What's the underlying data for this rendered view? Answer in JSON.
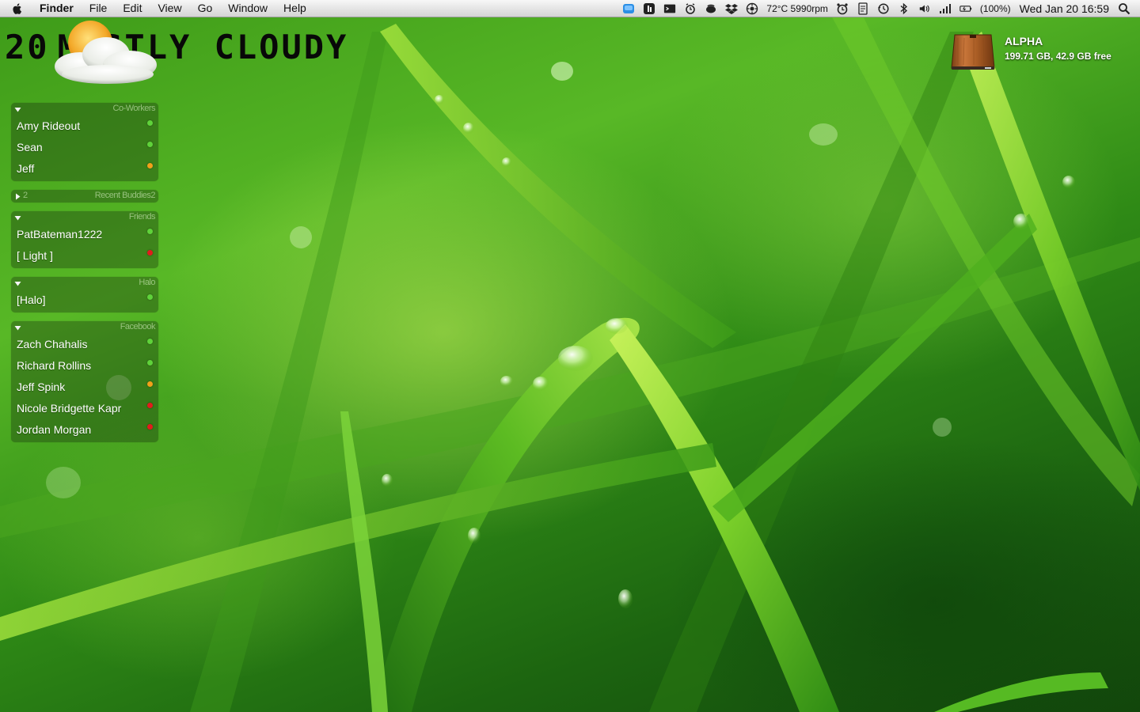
{
  "menubar": {
    "app_name": "Finder",
    "menus": [
      "File",
      "Edit",
      "View",
      "Go",
      "Window",
      "Help"
    ],
    "status_text": "72°C 5990rpm",
    "battery_text": "(100%)",
    "clock": "Wed Jan 20  16:59",
    "status_icons": [
      "app-blue-icon",
      "istat-icon",
      "terminal-icon",
      "alarm-icon",
      "growl-icon",
      "dropbox-icon",
      "system-monitor-icon",
      "clock-icon",
      "document-icon",
      "time-machine-icon",
      "bluetooth-icon",
      "volume-icon",
      "wifi-icon",
      "battery-icon",
      "spotlight-icon"
    ]
  },
  "weather": {
    "temperature": "20",
    "condition": "MOSTLY CLOUDY",
    "icon": "partly-cloudy-icon"
  },
  "drive": {
    "name": "ALPHA",
    "space": "199.71 GB, 42.9 GB free",
    "icon": "hard-drive-icon"
  },
  "colors": {
    "online": "#5fd23a",
    "away": "#f2a01a",
    "offline": "#e21c1c"
  },
  "buddy_groups": [
    {
      "name": "Co-Workers",
      "expanded": true,
      "buddies": [
        {
          "name": "Amy Rideout",
          "status": "online"
        },
        {
          "name": "Sean",
          "status": "online"
        },
        {
          "name": "Jeff",
          "status": "away"
        }
      ]
    },
    {
      "name": "Recent Buddies2",
      "count": "2",
      "expanded": false,
      "buddies": []
    },
    {
      "name": "Friends",
      "expanded": true,
      "buddies": [
        {
          "name": "PatBateman1222",
          "status": "online"
        },
        {
          "name": "[ Light ]",
          "status": "offline"
        }
      ]
    },
    {
      "name": "Halo",
      "expanded": true,
      "buddies": [
        {
          "name": "[Halo]",
          "status": "online"
        }
      ]
    },
    {
      "name": "Facebook",
      "expanded": true,
      "buddies": [
        {
          "name": "Zach Chahalis",
          "status": "online"
        },
        {
          "name": "Richard Rollins",
          "status": "online"
        },
        {
          "name": "Jeff Spink",
          "status": "away"
        },
        {
          "name": "Nicole Bridgette Kapr",
          "status": "offline"
        },
        {
          "name": "Jordan Morgan",
          "status": "offline"
        }
      ]
    }
  ]
}
